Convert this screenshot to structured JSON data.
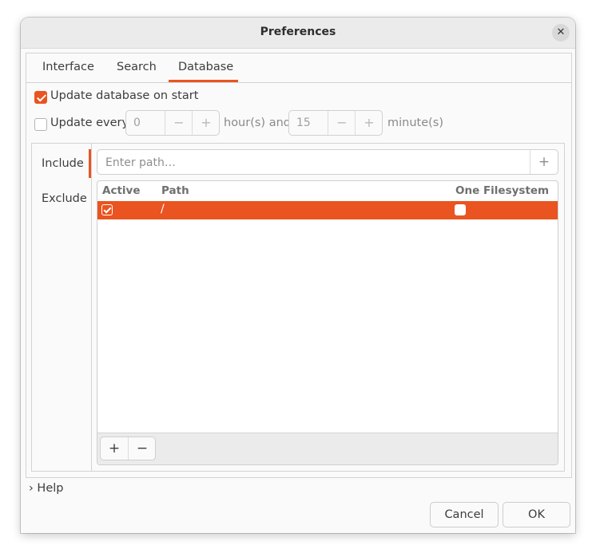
{
  "window": {
    "title": "Preferences"
  },
  "tabs": [
    {
      "label": "Interface"
    },
    {
      "label": "Search"
    },
    {
      "label": "Database",
      "active": true
    }
  ],
  "database": {
    "update_on_start": {
      "label": "Update database on start",
      "checked": true
    },
    "update_every": {
      "label": "Update every",
      "checked": false,
      "hours": "0",
      "hours_label": "hour(s) and",
      "minutes": "15",
      "minutes_label": "minute(s)"
    },
    "side_tabs": [
      {
        "label": "Include",
        "active": true
      },
      {
        "label": "Exclude"
      }
    ],
    "path_placeholder": "Enter path…",
    "table": {
      "columns": [
        "Active",
        "Path",
        "One Filesystem"
      ],
      "rows": [
        {
          "active": true,
          "path": "/",
          "one_filesystem": false,
          "selected": true
        }
      ]
    }
  },
  "icons": {
    "plus": "+",
    "minus": "−",
    "close": "✕",
    "chevron": "›"
  },
  "footer": {
    "help_label": "Help",
    "cancel_label": "Cancel",
    "ok_label": "OK"
  },
  "colors": {
    "accent": "#e95420"
  }
}
